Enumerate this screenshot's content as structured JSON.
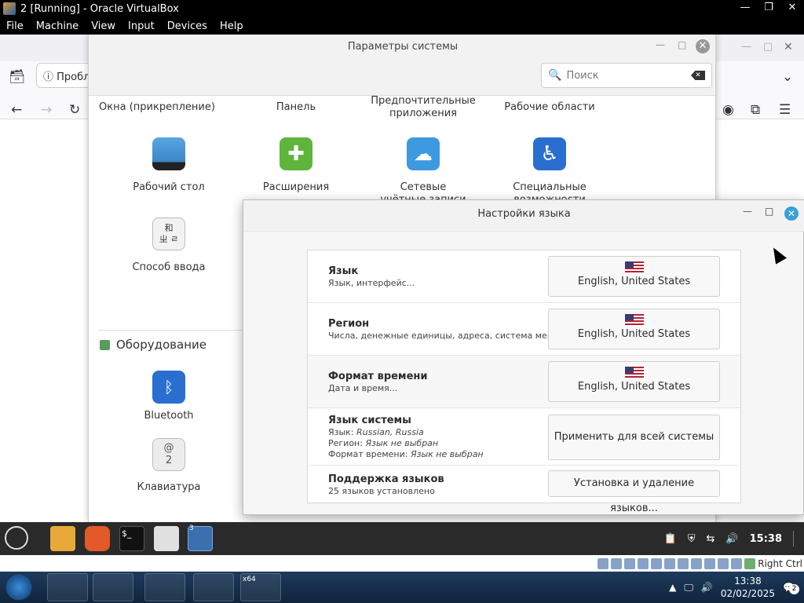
{
  "host": {
    "window_title": "2 [Running] - Oracle VirtualBox",
    "controls": {
      "minimize": "—",
      "maximize": "❐",
      "close": "✕"
    },
    "menu": [
      "File",
      "Machine",
      "View",
      "Input",
      "Devices",
      "Help"
    ],
    "status_right": "Right Ctrl"
  },
  "browser": {
    "tab_label": "Пробл"
  },
  "settings": {
    "title": "Параметры системы",
    "search": {
      "placeholder": "Поиск"
    },
    "top_row": [
      "Окна (прикрепление)",
      "Панель",
      "Предпочтительные приложения",
      "Рабочие области"
    ],
    "items_row1": [
      {
        "label": "Рабочий стол",
        "icon": "desktop-icon"
      },
      {
        "label": "Расширения",
        "icon": "puzzle-icon"
      },
      {
        "label": "Сетевые учётные записи",
        "icon": "cloud-icon"
      },
      {
        "label": "Специальные возможности",
        "icon": "accessibility-icon"
      }
    ],
    "items_row2": [
      {
        "label": "Способ ввода",
        "icon": "input-method-icon"
      }
    ],
    "section_hardware": "Оборудование",
    "hw_items": [
      {
        "label": "Bluetooth",
        "icon": "bluetooth-icon"
      },
      {
        "label": "Клавиатура",
        "icon": "keyboard-icon"
      }
    ],
    "input_glyph": "和\nㄓ ㄹ",
    "keyboard_glyph": "@\n2"
  },
  "language": {
    "title": "Настройки языка",
    "rows": [
      {
        "name": "Язык",
        "desc": "Язык, интерфейс...",
        "value": "English, United States"
      },
      {
        "name": "Регион",
        "desc": "Числа, денежные единицы, адреса, система мер...",
        "value": "English, United States"
      },
      {
        "name": "Формат времени",
        "desc": "Дата и время...",
        "value": "English, United States"
      }
    ],
    "system": {
      "name": "Язык системы",
      "lang_label": "Язык:",
      "lang_value": "Russian, Russia",
      "region_label": "Регион:",
      "region_value": "Язык не выбран",
      "time_label": "Формат времени:",
      "time_value": "Язык не выбран",
      "button": "Применить для всей системы"
    },
    "support": {
      "name": "Поддержка языков",
      "desc": "25 языков установлено",
      "button": "Установка и удаление языков..."
    }
  },
  "mint_panel": {
    "clock": "15:38",
    "badge": "3"
  },
  "windows": {
    "time": "13:38",
    "date": "02/02/2025",
    "notifications": "2",
    "x64_label": "x64"
  }
}
